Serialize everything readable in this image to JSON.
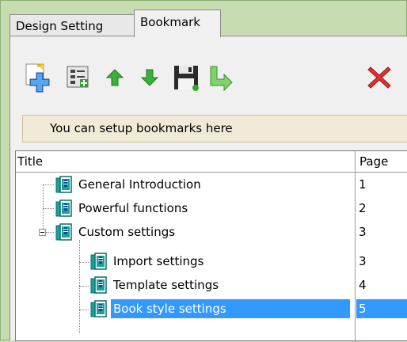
{
  "tabs": [
    {
      "label": "Design Setting",
      "active": false
    },
    {
      "label": "Bookmark",
      "active": true
    }
  ],
  "toolbar": {
    "buttons": [
      {
        "icon": "add-bookmark-icon"
      },
      {
        "icon": "add-child-bookmark-icon"
      },
      {
        "icon": "move-up-arrow-icon"
      },
      {
        "icon": "move-down-arrow-icon"
      },
      {
        "icon": "save-floppy-icon"
      },
      {
        "icon": "export-icon"
      },
      {
        "icon": "delete-x-icon"
      }
    ]
  },
  "info_text": "You can setup bookmarks here",
  "tree": {
    "columns": {
      "title": "Title",
      "page": "Page"
    },
    "rows": [
      {
        "label": "General Introduction",
        "page": "1",
        "level": 0
      },
      {
        "label": "Powerful functions",
        "page": "2",
        "level": 0
      },
      {
        "label": "Custom settings",
        "page": "3",
        "level": 0,
        "expanded": true
      },
      {
        "label": "Import settings",
        "page": "3",
        "level": 1
      },
      {
        "label": "Template settings",
        "page": "4",
        "level": 1
      },
      {
        "label": "Book style settings",
        "page": "5",
        "level": 1,
        "selected": true
      }
    ]
  },
  "colors": {
    "background": "#c7dcb0",
    "selection": "#3399ff",
    "info_bg": "#f1ead6"
  }
}
